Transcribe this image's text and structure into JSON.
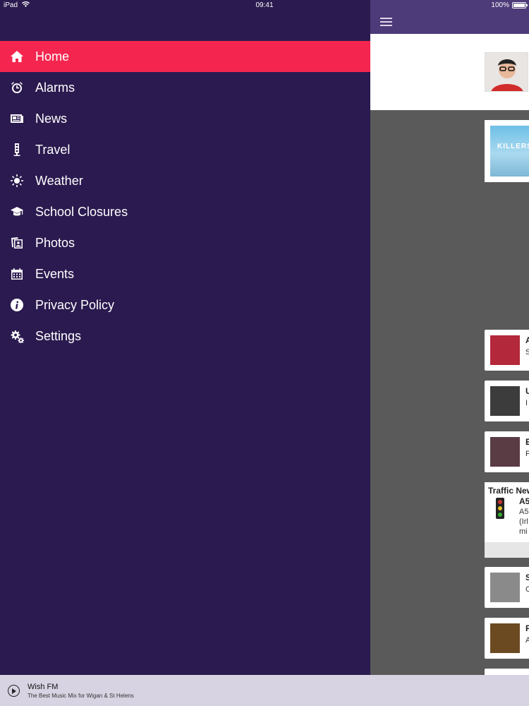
{
  "status": {
    "device": "iPad",
    "time": "09:41",
    "battery": "100%"
  },
  "menu": {
    "items": [
      {
        "label": "Home",
        "icon": "home-icon",
        "active": true
      },
      {
        "label": "Alarms",
        "icon": "alarm-clock-icon"
      },
      {
        "label": "News",
        "icon": "newspaper-icon"
      },
      {
        "label": "Travel",
        "icon": "traffic-light-icon"
      },
      {
        "label": "Weather",
        "icon": "sun-icon"
      },
      {
        "label": "School Closures",
        "icon": "graduation-cap-icon"
      },
      {
        "label": "Photos",
        "icon": "photos-icon"
      },
      {
        "label": "Events",
        "icon": "calendar-icon"
      },
      {
        "label": "Privacy Policy",
        "icon": "info-icon"
      },
      {
        "label": "Settings",
        "icon": "gears-icon"
      }
    ]
  },
  "content": {
    "album_art_text": "KILLERS",
    "tracks": [
      {
        "line1": "A",
        "line2": "S"
      },
      {
        "line1": "U",
        "line2": "I"
      },
      {
        "line1": "E",
        "line2": "F"
      },
      {
        "line1": "S",
        "line2": "C"
      },
      {
        "line1": "F",
        "line2": "A"
      }
    ],
    "traffic": {
      "title": "Traffic New",
      "road": "A5",
      "detail1": "A5",
      "detail2": "(Irl",
      "detail3": "mi"
    }
  },
  "player": {
    "station": "Wish FM",
    "tagline": "The Best Music Mix for Wigan & St Helens"
  },
  "colors": {
    "drawer": "#2b1a4f",
    "active": "#f4264f",
    "topbar": "#4d3a78",
    "player": "#d7d3e2"
  }
}
